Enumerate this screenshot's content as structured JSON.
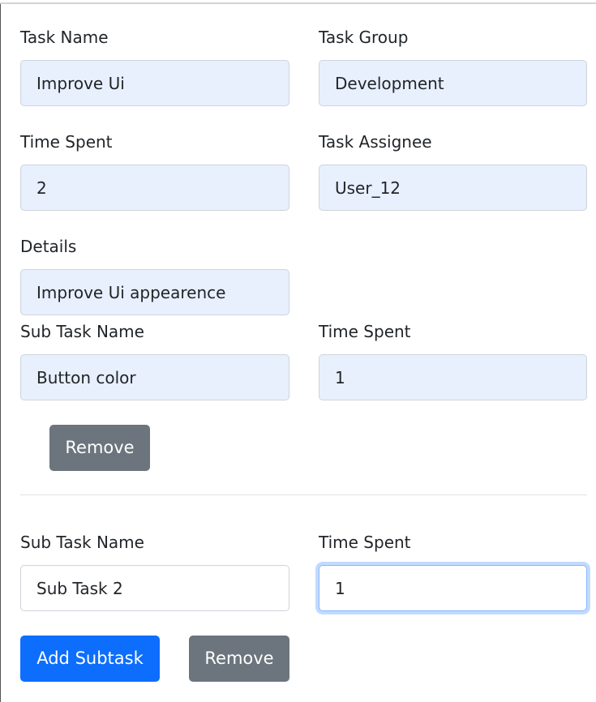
{
  "task": {
    "name_label": "Task Name",
    "name_value": "Improve Ui",
    "group_label": "Task Group",
    "group_value": "Development",
    "time_label": "Time Spent",
    "time_value": "2",
    "assignee_label": "Task Assignee",
    "assignee_value": "User_12",
    "details_label": "Details",
    "details_value": "Improve Ui appearence"
  },
  "subtasks": [
    {
      "name_label": "Sub Task Name",
      "name_value": "Button color",
      "time_label": "Time Spent",
      "time_value": "1",
      "remove_label": "Remove"
    },
    {
      "name_label": "Sub Task Name",
      "name_value": "Sub Task 2",
      "time_label": "Time Spent",
      "time_value": "1",
      "remove_label": "Remove"
    }
  ],
  "actions": {
    "add_subtask_label": "Add Subtask"
  }
}
